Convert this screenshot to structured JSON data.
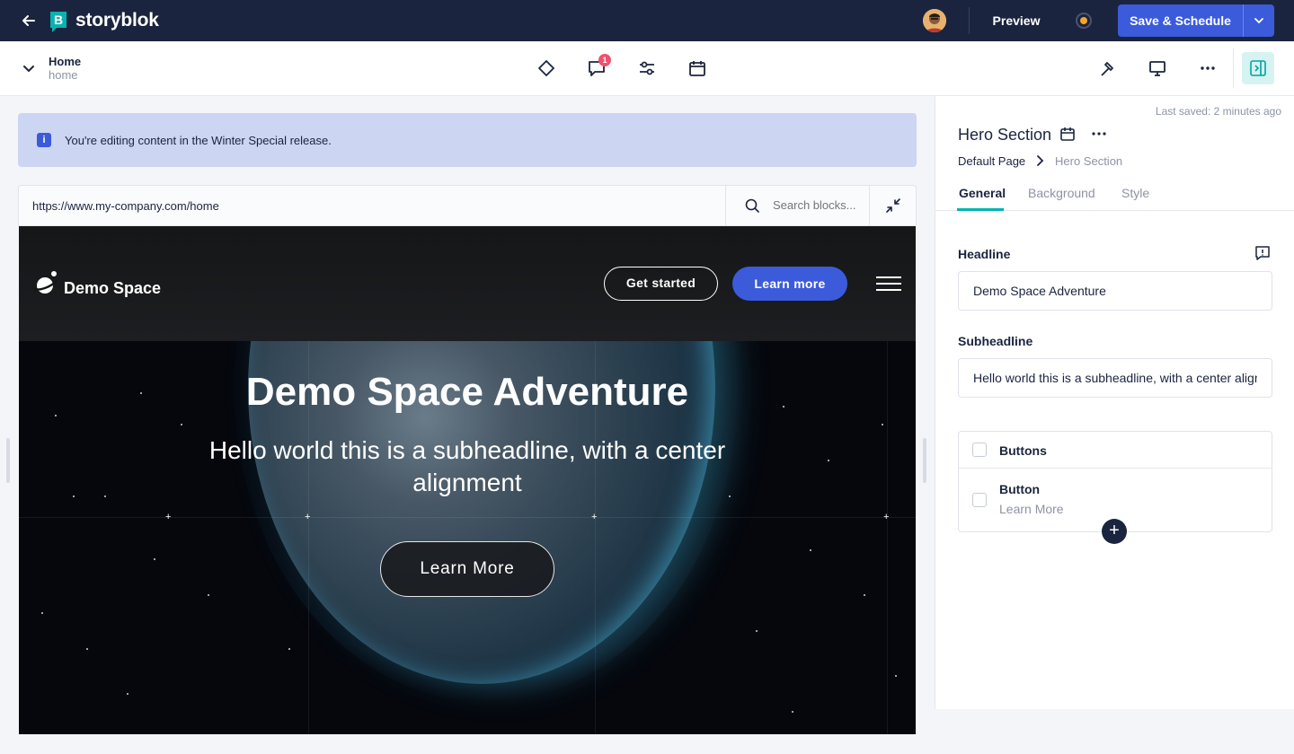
{
  "topbar": {
    "brand": "storyblok",
    "preview_label": "Preview",
    "save_label": "Save & Schedule",
    "status_color": "#f5a623",
    "accent": "#3b5bdb"
  },
  "story": {
    "title": "Home",
    "slug": "home",
    "comments_badge": "1"
  },
  "notice": {
    "text": "You're editing content in the Winter Special release."
  },
  "urlbar": {
    "url": "https://www.my-company.com/home",
    "search_placeholder": "Search blocks..."
  },
  "preview": {
    "site_name": "Demo Space",
    "nav_get_started": "Get started",
    "nav_learn_more": "Learn more",
    "headline": "Demo Space Adventure",
    "subheadline": "Hello world this is a subheadline, with a center alignment",
    "cta": "Learn More"
  },
  "panel": {
    "last_saved": "Last saved: 2 minutes ago",
    "component_title": "Hero Section",
    "breadcrumb": [
      "Default Page",
      "Hero Section"
    ],
    "tabs": [
      "General",
      "Background",
      "Style"
    ],
    "active_tab": "General",
    "fields": {
      "headline_label": "Headline",
      "headline_value": "Demo Space Adventure",
      "subheadline_label": "Subheadline",
      "subheadline_value": "Hello world this is a subheadline, with a center alignment"
    },
    "blocks": {
      "header": "Buttons",
      "items": [
        {
          "name": "Button",
          "value": "Learn More"
        }
      ]
    },
    "add_label": "+"
  },
  "icons": {
    "back": "arrow-left-icon",
    "toolbar": [
      "diamond-icon",
      "comment-icon",
      "sliders-icon",
      "calendar-icon"
    ],
    "right_toolbar": [
      "hammer-icon",
      "desktop-icon",
      "more-icon",
      "panel-toggle-icon"
    ]
  }
}
